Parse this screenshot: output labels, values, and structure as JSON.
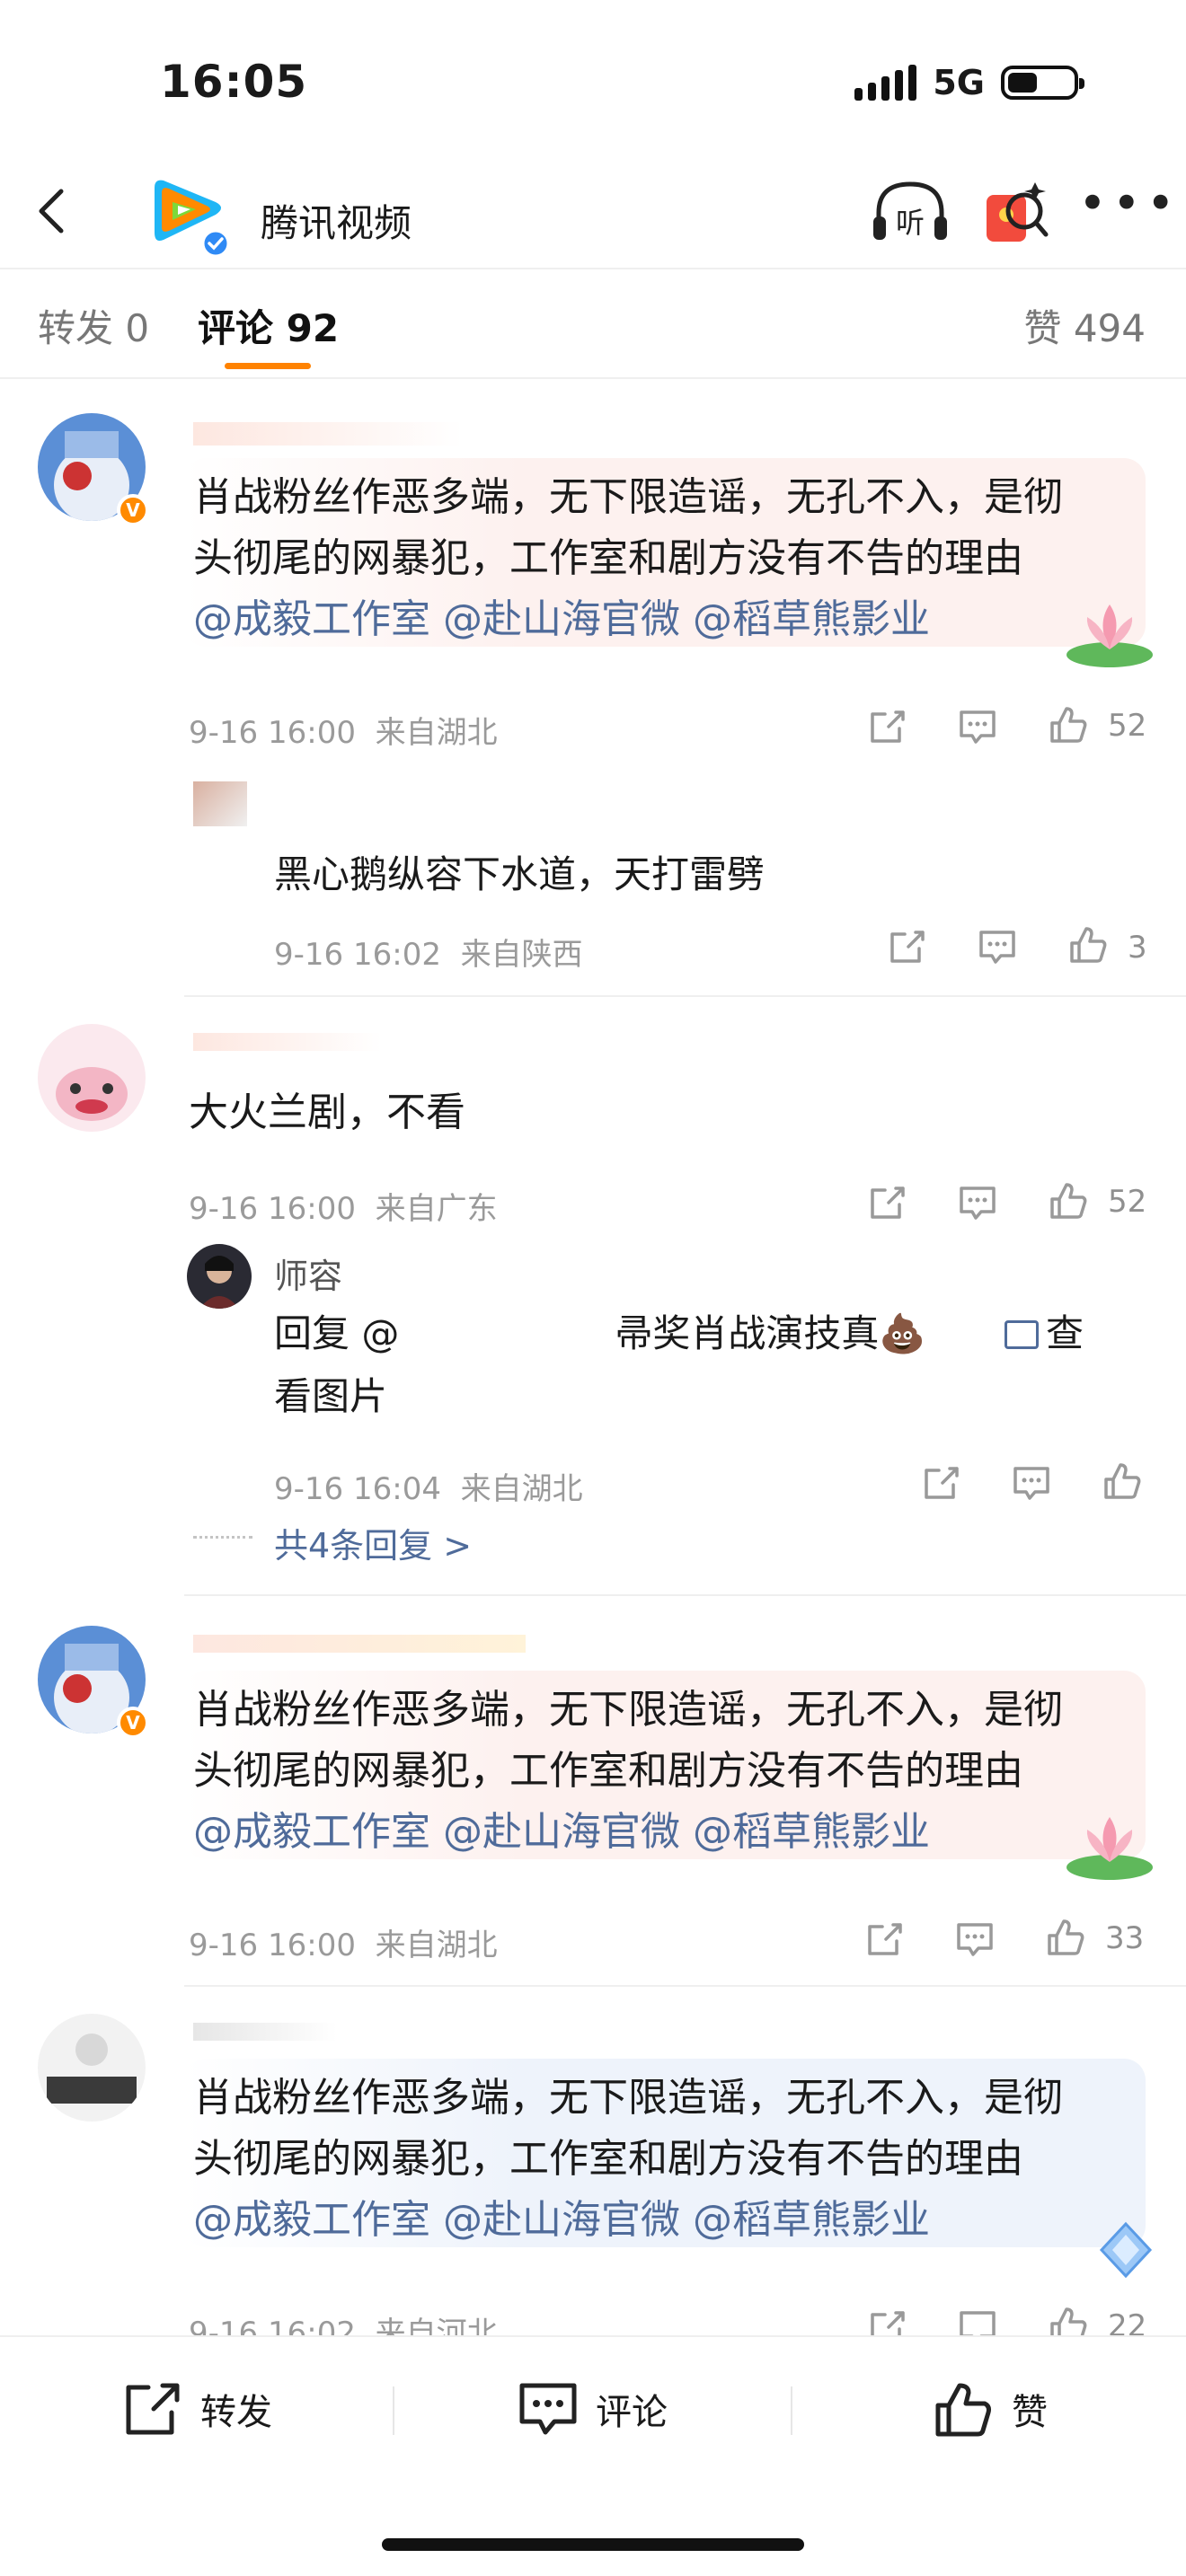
{
  "status": {
    "time": "16:05",
    "network": "5G"
  },
  "header": {
    "title": "腾讯视频"
  },
  "tabs": {
    "repost": "转发 0",
    "comments": "评论 92",
    "likes": "赞 494"
  },
  "comments": [
    {
      "text_plain": "肖战粉丝作恶多端，无下限造谣，无孔不入，是彻头彻尾的网暴犯，工作室和剧方没有不告的理由",
      "line1": "肖战粉丝作恶多端，无下限造谣，无孔不入，是彻",
      "line2": "头彻尾的网暴犯，工作室和剧方没有不告的理由",
      "mentions": "@成毅工作室 @赴山海官微 @稻草熊影业",
      "time": "9-16 16:00",
      "location": "来自湖北",
      "likes": "52",
      "replies": [
        {
          "text": "黑心鹅纵容下水道，天打雷劈",
          "time": "9-16 16:02",
          "location": "来自陕西",
          "likes": "3"
        }
      ]
    },
    {
      "text": "大火兰剧，不看",
      "time": "9-16 16:00",
      "location": "来自广东",
      "likes": "52",
      "replies": [
        {
          "name": "师容",
          "line1_prefix": "回复 @",
          "line1_suffix": "帚奖肖战演技真💩",
          "view_pic": "查",
          "line2": "看图片",
          "time": "9-16 16:04",
          "location": "来自湖北"
        }
      ],
      "more_replies": "共4条回复 >"
    },
    {
      "line1": "肖战粉丝作恶多端，无下限造谣，无孔不入，是彻",
      "line2": "头彻尾的网暴犯，工作室和剧方没有不告的理由",
      "mentions": "@成毅工作室 @赴山海官微 @稻草熊影业",
      "time": "9-16 16:00",
      "location": "来自湖北",
      "likes": "33"
    },
    {
      "line1": "肖战粉丝作恶多端，无下限造谣，无孔不入，是彻",
      "line2": "头彻尾的网暴犯，工作室和剧方没有不告的理由",
      "mentions": "@成毅工作室 @赴山海官微 @稻草熊影业",
      "time": "9-16 16:02",
      "location": "来自河北",
      "likes": "22"
    }
  ],
  "bottom_bar": {
    "repost": "转发",
    "comment": "评论",
    "like": "赞"
  },
  "colors": {
    "accent": "#ff8200",
    "mention": "#4f6b9a",
    "pink_bubble": "#fdf1ef",
    "blue_bubble": "#eef3fb"
  }
}
